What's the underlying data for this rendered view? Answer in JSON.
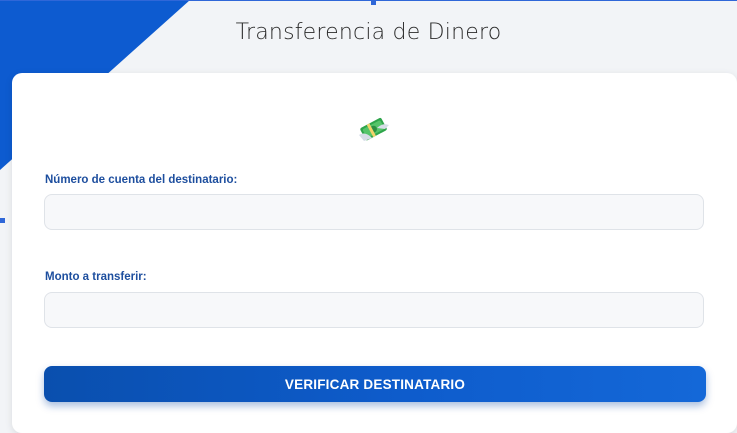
{
  "header": {
    "title": "Transferencia de Dinero"
  },
  "form": {
    "account_label": "Número de cuenta del destinatario:",
    "account_value": "",
    "amount_label": "Monto a transferir:",
    "amount_value": "",
    "submit_label": "VERIFICAR DESTINATARIO"
  },
  "icons": {
    "header_icon": "money-with-wings-icon"
  },
  "colors": {
    "accent": "#0a4fae",
    "label": "#1d4e9e",
    "triangle": "#0d5bd0"
  }
}
